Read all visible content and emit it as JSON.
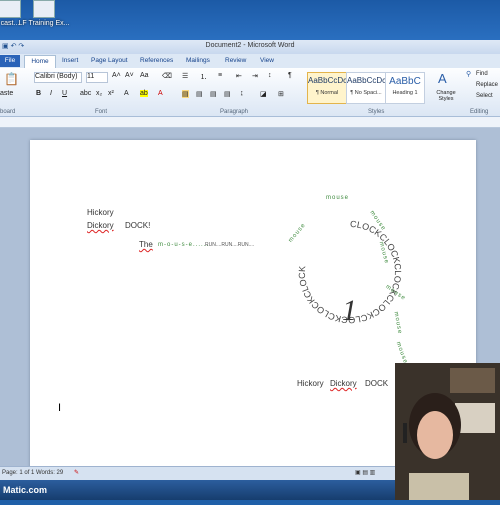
{
  "desktop": {
    "icons": [
      {
        "label": "cast..."
      },
      {
        "label": "LF Training Ex..."
      }
    ]
  },
  "window": {
    "title": "Document2 - Microsoft Word",
    "tabs": [
      "File",
      "Home",
      "Insert",
      "Page Layout",
      "References",
      "Mailings",
      "Review",
      "View"
    ]
  },
  "ribbon": {
    "font_name": "Calibri (Body)",
    "font_size": "11",
    "paste_label": "aste",
    "clipboard_label": "board",
    "font_group": "Font",
    "paragraph_group": "Paragraph",
    "styles_group": "Styles",
    "editing_group": "Editing",
    "styles": [
      {
        "sample": "AaBbCcDc",
        "name": "¶ Normal"
      },
      {
        "sample": "AaBbCcDc",
        "name": "¶ No Spaci..."
      },
      {
        "sample": "AaBbC",
        "name": "Heading 1"
      }
    ],
    "change_styles": "Change Styles",
    "find": "Find",
    "replace": "Replace",
    "select": "Select"
  },
  "document": {
    "line1": "Hickory",
    "line2_word1": "Dickory",
    "line2_word2": "DOCK!",
    "the_word": "The",
    "mouse_spaced": "m-o-u-s-e......",
    "run_text": "RUN....RUN....RUN....",
    "circle_text": "CLOCKCLOCKCLOCKCLOCKCLOCKCLOCKCLOCK",
    "clock_number": "1",
    "mouse_path": [
      "mouse",
      "mouse",
      "mouse",
      "mouse",
      "mouse",
      "mouse",
      "mouse"
    ],
    "bottom_line_1": "Hickory",
    "bottom_line_2": "Dickory",
    "bottom_line_3": "DOCK",
    "cursor": "I"
  },
  "status": {
    "page": "Page: 1 of 1",
    "words": "Words: 29"
  },
  "taskbar": {
    "brand": "Matic.com"
  }
}
